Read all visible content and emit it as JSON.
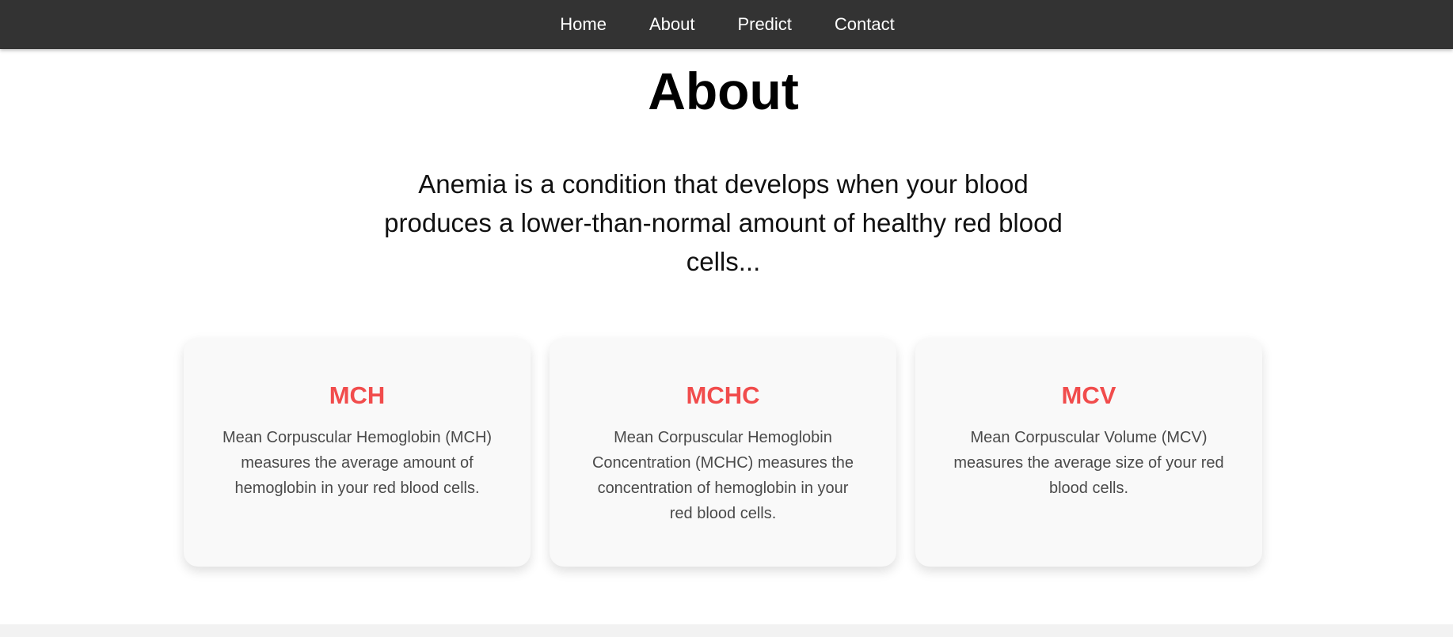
{
  "nav": {
    "items": [
      {
        "label": "Home"
      },
      {
        "label": "About"
      },
      {
        "label": "Predict"
      },
      {
        "label": "Contact"
      }
    ]
  },
  "about": {
    "title": "About",
    "intro": "Anemia is a condition that develops when your blood produces a lower-than-normal amount of healthy red blood cells..."
  },
  "cards": [
    {
      "title": "MCH",
      "text": "Mean Corpuscular Hemoglobin (MCH) measures the average amount of hemoglobin in your red blood cells."
    },
    {
      "title": "MCHC",
      "text": "Mean Corpuscular Hemoglobin Concentration (MCHC) measures the concentration of hemoglobin in your red blood cells."
    },
    {
      "title": "MCV",
      "text": "Mean Corpuscular Volume (MCV) measures the average size of your red blood cells."
    }
  ],
  "colors": {
    "navbar_bg": "#333333",
    "accent": "#f14c4c",
    "card_bg": "#f9f9f9"
  }
}
